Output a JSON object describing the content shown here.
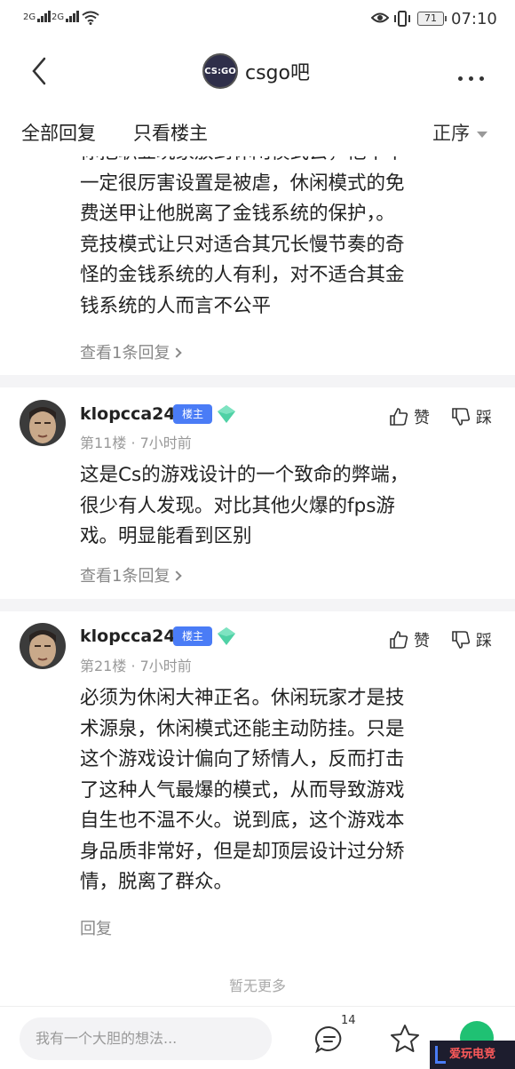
{
  "status_bar": {
    "signal1": "2G",
    "signal2": "2G",
    "battery": "71",
    "time": "07:10"
  },
  "nav": {
    "forum_logo_text": "CS:GO",
    "forum_name": "csgo吧"
  },
  "filters": {
    "all_replies": "全部回复",
    "only_op": "只看楼主",
    "sort": "正序"
  },
  "posts": [
    {
      "lines": [
        "你把职业玩家放到休闲模式去，他不不",
        "一定很厉害设置是被虐，休闲模式的免",
        "费送甲让他脱离了金钱系统的保护，。",
        "竞技模式让只对适合其冗长慢节奏的奇",
        "怪的金钱系统的人有利，对不适合其金",
        "钱系统的人而言不公平"
      ],
      "reply_link": "查看1条回复"
    },
    {
      "username": "klopcca24",
      "badge": "楼主",
      "meta": "第11楼 · 7小时前",
      "like": "赞",
      "dislike": "踩",
      "lines": [
        "这是Cs的游戏设计的一个致命的弊端，",
        "很少有人发现。对比其他火爆的fps游",
        "戏。明显能看到区别"
      ],
      "reply_link": "查看1条回复"
    },
    {
      "username": "klopcca24",
      "badge": "楼主",
      "meta": "第21楼 · 7小时前",
      "like": "赞",
      "dislike": "踩",
      "lines": [
        "必须为休闲大神正名。休闲玩家才是技",
        "术源泉，休闲模式还能主动防挂。只是",
        "这个游戏设计偏向了矫情人，反而打击",
        "了这种人气最爆的模式，从而导致游戏",
        "自生也不温不火。说到底，这个游戏本",
        "身品质非常好，但是却顶层设计过分矫",
        "情，脱离了群众。"
      ],
      "reply_link": "回复"
    }
  ],
  "footer": {
    "no_more": "暂无更多",
    "input_placeholder": "我有一个大胆的想法...",
    "comment_count": "14",
    "watermark": "爱玩电竞"
  }
}
